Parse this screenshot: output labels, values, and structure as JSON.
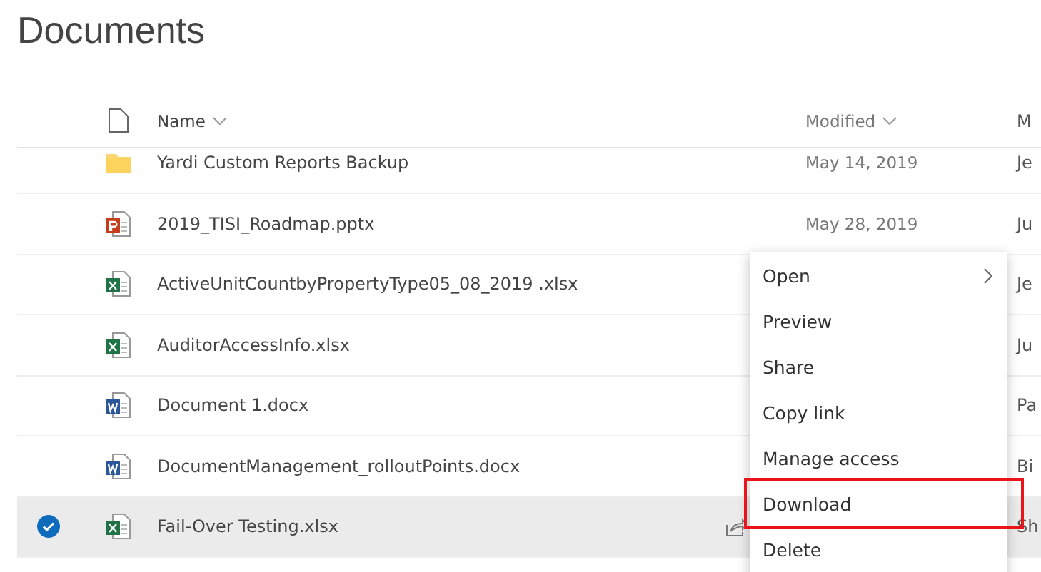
{
  "title": "Documents",
  "columns": {
    "name": "Name",
    "modified": "Modified",
    "column_4": "M"
  },
  "rows": [
    {
      "kind": "folder",
      "name": "Yardi Custom Reports Backup",
      "modified": "May 14, 2019",
      "column_4": "Je",
      "selected": false
    },
    {
      "kind": "pptx",
      "name": "2019_TISI_Roadmap.pptx",
      "modified": "May 28, 2019",
      "column_4": "Ju",
      "selected": false
    },
    {
      "kind": "xlsx",
      "name": "ActiveUnitCountbyPropertyType05_08_2019 .xlsx",
      "column_4": "Je",
      "selected": false
    },
    {
      "kind": "xlsx",
      "name": "AuditorAccessInfo.xlsx",
      "column_4": "Ju",
      "selected": false
    },
    {
      "kind": "docx",
      "name": "Document 1.docx",
      "column_4": "Pa",
      "selected": false
    },
    {
      "kind": "docx",
      "name": "DocumentManagement_rolloutPoints.docx",
      "column_4": "Bi",
      "selected": false
    },
    {
      "kind": "xlsx",
      "name": "Fail-Over Testing.xlsx",
      "column_4": "Sh",
      "selected": true
    }
  ],
  "context_menu": [
    {
      "label": "Open",
      "submenu": true,
      "highlighted": false
    },
    {
      "label": "Preview",
      "submenu": false,
      "highlighted": false
    },
    {
      "label": "Share",
      "submenu": false,
      "highlighted": false
    },
    {
      "label": "Copy link",
      "submenu": false,
      "highlighted": false
    },
    {
      "label": "Manage access",
      "submenu": false,
      "highlighted": false
    },
    {
      "label": "Download",
      "submenu": false,
      "highlighted": true
    },
    {
      "label": "Delete",
      "submenu": false,
      "highlighted": false
    }
  ]
}
